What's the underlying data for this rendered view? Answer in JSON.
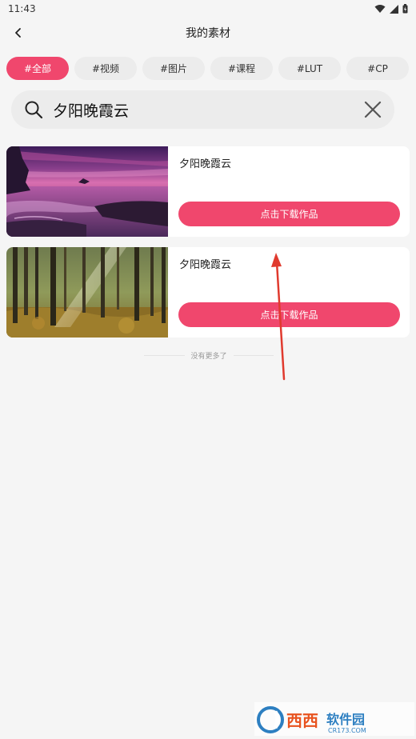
{
  "status_bar": {
    "time": "11:43"
  },
  "header": {
    "title": "我的素材"
  },
  "tags": [
    {
      "label": "#全部",
      "active": true
    },
    {
      "label": "#视频",
      "active": false
    },
    {
      "label": "#图片",
      "active": false
    },
    {
      "label": "#课程",
      "active": false
    },
    {
      "label": "#LUT",
      "active": false
    },
    {
      "label": "#CP",
      "active": false
    }
  ],
  "search": {
    "value": "夕阳晚霞云"
  },
  "items": [
    {
      "title": "夕阳晚霞云",
      "button": "点击下载作品",
      "thumb": "purple-sunset-sea"
    },
    {
      "title": "夕阳晚霞云",
      "button": "点击下载作品",
      "thumb": "sunlit-forest"
    }
  ],
  "footer": {
    "no_more": "没有更多了"
  },
  "colors": {
    "accent": "#f0476d",
    "background": "#f5f5f5",
    "annotation_arrow": "#e03a2e"
  },
  "watermark": {
    "text": "西西软件园",
    "sub": "CR173.COM"
  }
}
